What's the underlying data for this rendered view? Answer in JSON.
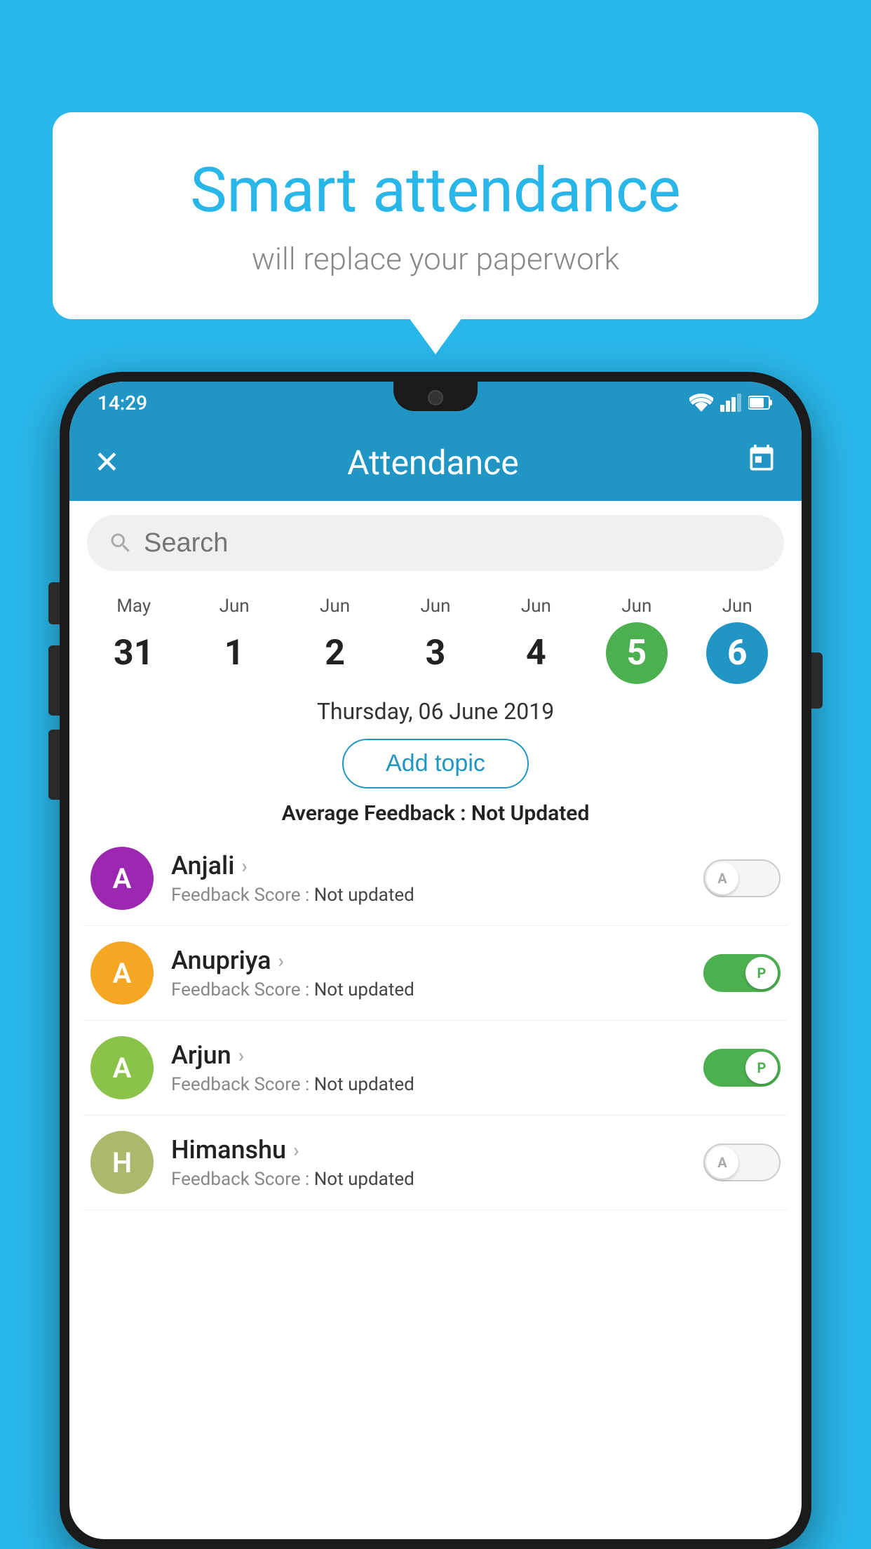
{
  "background_color": "#29b6e8",
  "speech_bubble": {
    "title": "Smart attendance",
    "subtitle": "will replace your paperwork"
  },
  "status_bar": {
    "time": "14:29"
  },
  "app_bar": {
    "title": "Attendance",
    "close_label": "✕",
    "calendar_label": "📅"
  },
  "search": {
    "placeholder": "Search"
  },
  "calendar": {
    "days": [
      {
        "month": "May",
        "date": "31",
        "highlight": "none"
      },
      {
        "month": "Jun",
        "date": "1",
        "highlight": "none"
      },
      {
        "month": "Jun",
        "date": "2",
        "highlight": "none"
      },
      {
        "month": "Jun",
        "date": "3",
        "highlight": "none"
      },
      {
        "month": "Jun",
        "date": "4",
        "highlight": "none"
      },
      {
        "month": "Jun",
        "date": "5",
        "highlight": "green"
      },
      {
        "month": "Jun",
        "date": "6",
        "highlight": "blue"
      }
    ]
  },
  "selected_date": "Thursday, 06 June 2019",
  "add_topic_label": "Add topic",
  "average_feedback": {
    "label": "Average Feedback : ",
    "value": "Not Updated"
  },
  "students": [
    {
      "name": "Anjali",
      "initials": "A",
      "avatar_color": "#9c27b0",
      "feedback_label": "Feedback Score : ",
      "feedback_value": "Not updated",
      "toggle_state": "off",
      "toggle_letter": "A"
    },
    {
      "name": "Anupriya",
      "initials": "A",
      "avatar_color": "#f5a623",
      "feedback_label": "Feedback Score : ",
      "feedback_value": "Not updated",
      "toggle_state": "on",
      "toggle_letter": "P"
    },
    {
      "name": "Arjun",
      "initials": "A",
      "avatar_color": "#8bc34a",
      "feedback_label": "Feedback Score : ",
      "feedback_value": "Not updated",
      "toggle_state": "on",
      "toggle_letter": "P"
    },
    {
      "name": "Himanshu",
      "initials": "H",
      "avatar_color": "#adb86d",
      "feedback_label": "Feedback Score : ",
      "feedback_value": "Not updated",
      "toggle_state": "off",
      "toggle_letter": "A"
    }
  ]
}
